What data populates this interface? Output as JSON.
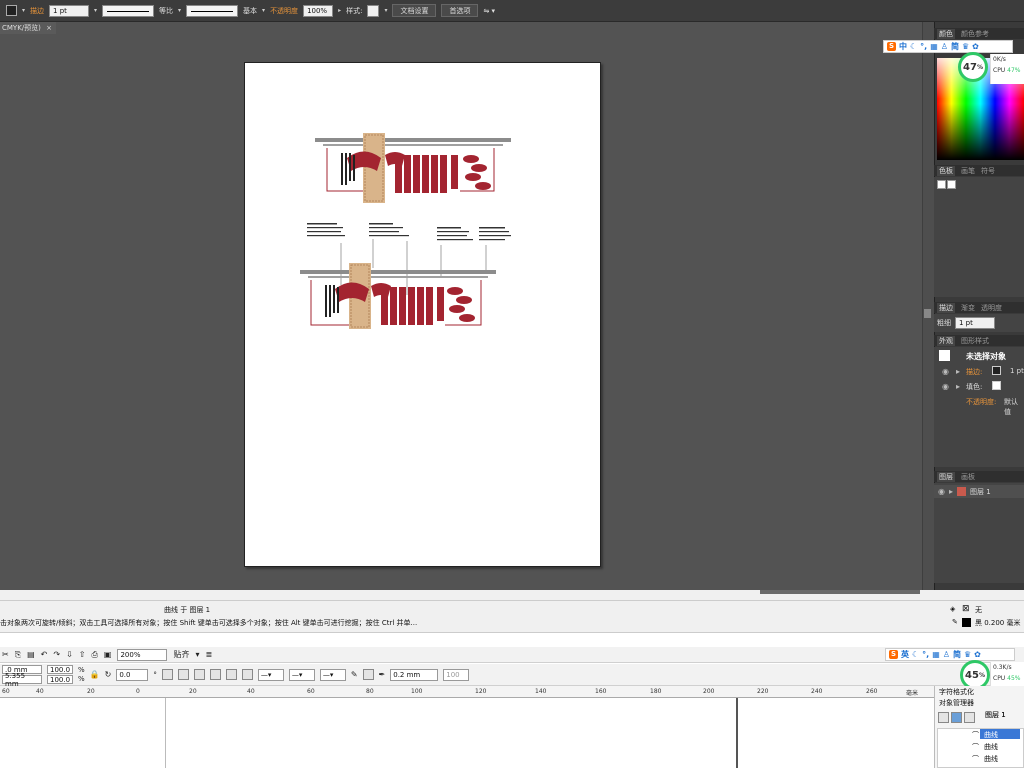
{
  "illustrator": {
    "control_bar": {
      "stroke_label": "描边",
      "stroke_weight": "1 pt",
      "profile_uniform": "等比",
      "brush_basic": "基本",
      "opacity_label": "不透明度",
      "opacity_value": "100%",
      "style_label": "样式:",
      "doc_setup_button": "文档设置",
      "prefs_button": "首选项"
    },
    "doc_tab": "CMYK/预览)",
    "close_glyph": "×",
    "panels": {
      "color_tabs": [
        "颜色",
        "颜色参考"
      ],
      "swatch_tabs": [
        "色板",
        "画笔",
        "符号"
      ],
      "stroke_tabs": [
        "描边",
        "渐变",
        "透明度"
      ],
      "stroke_weight_label": "粗细",
      "stroke_weight_value": "1 pt",
      "appearance_tabs": [
        "外观",
        "图形样式"
      ],
      "appearance_title": "未选择对象",
      "appearance_rows": [
        {
          "label": "描边:",
          "value": "1 pt"
        },
        {
          "label": "填色:",
          "value": ""
        },
        {
          "label": "不透明度:",
          "value": "默认值"
        }
      ],
      "layers_tabs": [
        "图层",
        "画板"
      ],
      "layer_name": "图层 1"
    }
  },
  "ime_widget_top": {
    "mode": "中",
    "simp": "简"
  },
  "ime_widget_bottom": {
    "mode": "英",
    "simp": "简"
  },
  "cpu_top": {
    "percent": "47",
    "unit": "%",
    "speed": "0K/s",
    "cpu_label": "CPU",
    "cpu_value": "47%"
  },
  "cpu_bottom": {
    "percent": "45",
    "unit": "%",
    "speed": "0.3K/s",
    "cpu_label": "CPU",
    "cpu_value": "45%"
  },
  "corel": {
    "curve_status": "曲线 于 图层 1",
    "hint_text": "击对象两次可旋转/倾斜；双击工具可选择所有对象；按住 Shift 键单击可选择多个对象；按住 Alt 键单击可进行挖掘；按住 Ctrl 并单...",
    "fill_none": "无",
    "outline_info": "黑  0.200 毫米",
    "zoom": "200%",
    "snap_label": "贴齐",
    "width_value": ".0 mm",
    "height_value": "5.355 mm",
    "scale_x": "100.0",
    "scale_y": "100.0",
    "percent": "%",
    "rotation": "0.0",
    "degree": "°",
    "outline_width": "0.2 mm",
    "smooth_value": "100",
    "ruler_ticks": [
      "60",
      "40",
      "20",
      "0",
      "20",
      "40",
      "60",
      "80",
      "100",
      "120",
      "140",
      "160",
      "180",
      "200",
      "220",
      "240",
      "260",
      "280"
    ],
    "ruler_unit": "毫米",
    "docker_titles": [
      "字符格式化",
      "对象管理器"
    ],
    "object_tree": [
      "图层 1",
      "曲线",
      "曲线",
      "曲线"
    ],
    "tree_header": "图层 1"
  },
  "colors": {
    "ai_bg": "#535353",
    "accent_red": "#a32430",
    "accent_orange": "#e8943a",
    "cpu_green": "#2ec866"
  }
}
